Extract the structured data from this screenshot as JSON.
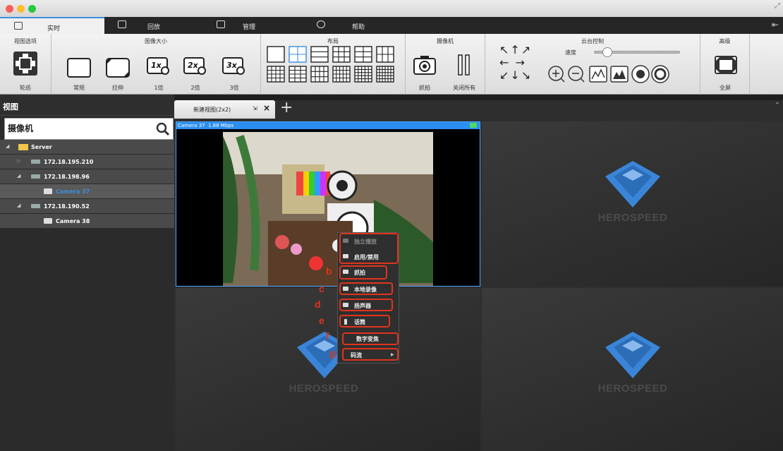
{
  "tabs": [
    {
      "label": "实时"
    },
    {
      "label": "回放"
    },
    {
      "label": "管理"
    },
    {
      "label": "帮助"
    }
  ],
  "toolbar": {
    "view_options": {
      "title": "视图选项",
      "tour_label": "轮巡"
    },
    "image_size": {
      "title": "图像大小",
      "normal": "常规",
      "stretch": "拉伸",
      "x1": "1倍",
      "x2": "2倍",
      "x3": "3倍",
      "x1_glyph": "1x",
      "x2_glyph": "2x",
      "x3_glyph": "3x"
    },
    "layout": {
      "title": "布局"
    },
    "camera": {
      "title": "摄像机",
      "snapshot": "抓拍",
      "close_all": "关闭所有"
    },
    "ptz": {
      "title": "云台控制",
      "speed": "速度",
      "speed_value": 0.1
    },
    "advanced": {
      "title": "高级",
      "fullscreen": "全屏"
    }
  },
  "left_panel": {
    "title": "视图",
    "search_value": "摄像机",
    "tree": [
      {
        "label": "Server"
      },
      {
        "label": "172.18.195.210"
      },
      {
        "label": "172.18.198.96"
      },
      {
        "label": "Camera 37"
      },
      {
        "label": "172.18.190.52"
      },
      {
        "label": "Camera 38"
      }
    ]
  },
  "view_tab": {
    "label": "新建视图(2x2)"
  },
  "camera_cell": {
    "name": "Camera 37",
    "bitrate": "1.88 Mbps"
  },
  "brand": "HEROSPEED",
  "context_menu": [
    {
      "label": "独立播放",
      "disabled": true
    },
    {
      "label": "启用/禁用"
    },
    {
      "label": "抓拍"
    },
    {
      "label": "本地录像"
    },
    {
      "label": "扬声器"
    },
    {
      "label": "话筒"
    },
    {
      "label": "数字变焦"
    },
    {
      "label": "码流"
    }
  ],
  "annotations": [
    "b",
    "c",
    "d",
    "e",
    "f",
    "g"
  ],
  "colors": {
    "accent": "#2b8ef0",
    "annotation": "#e0341c",
    "brand_blue": "#3a85d8"
  }
}
